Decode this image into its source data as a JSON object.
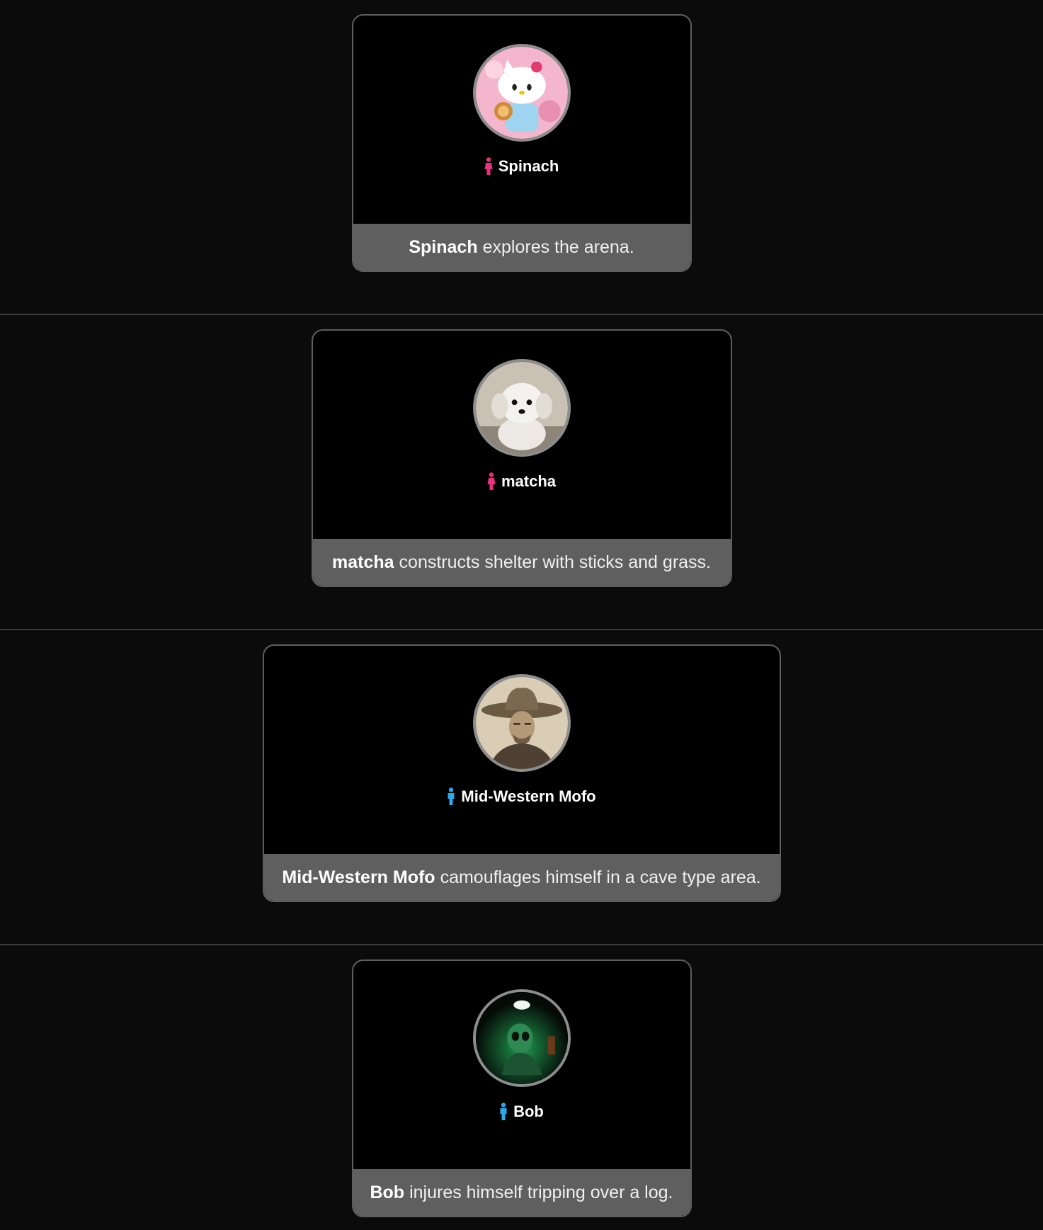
{
  "events": [
    {
      "tribute": "Spinach",
      "gender": "female",
      "gender_color": "#e8307e",
      "avatar_icon": "hello-kitty-avatar",
      "action": "explores the arena."
    },
    {
      "tribute": "matcha",
      "gender": "female",
      "gender_color": "#e8307e",
      "avatar_icon": "puppy-avatar",
      "action": "constructs shelter with sticks and grass."
    },
    {
      "tribute": "Mid-Western Mofo",
      "gender": "male",
      "gender_color": "#2fa7e8",
      "avatar_icon": "cowboy-avatar",
      "action": "camouflages himself in a cave type area."
    },
    {
      "tribute": "Bob",
      "gender": "male",
      "gender_color": "#2fa7e8",
      "avatar_icon": "green-skull-avatar",
      "action": "injures himself tripping over a log."
    }
  ]
}
